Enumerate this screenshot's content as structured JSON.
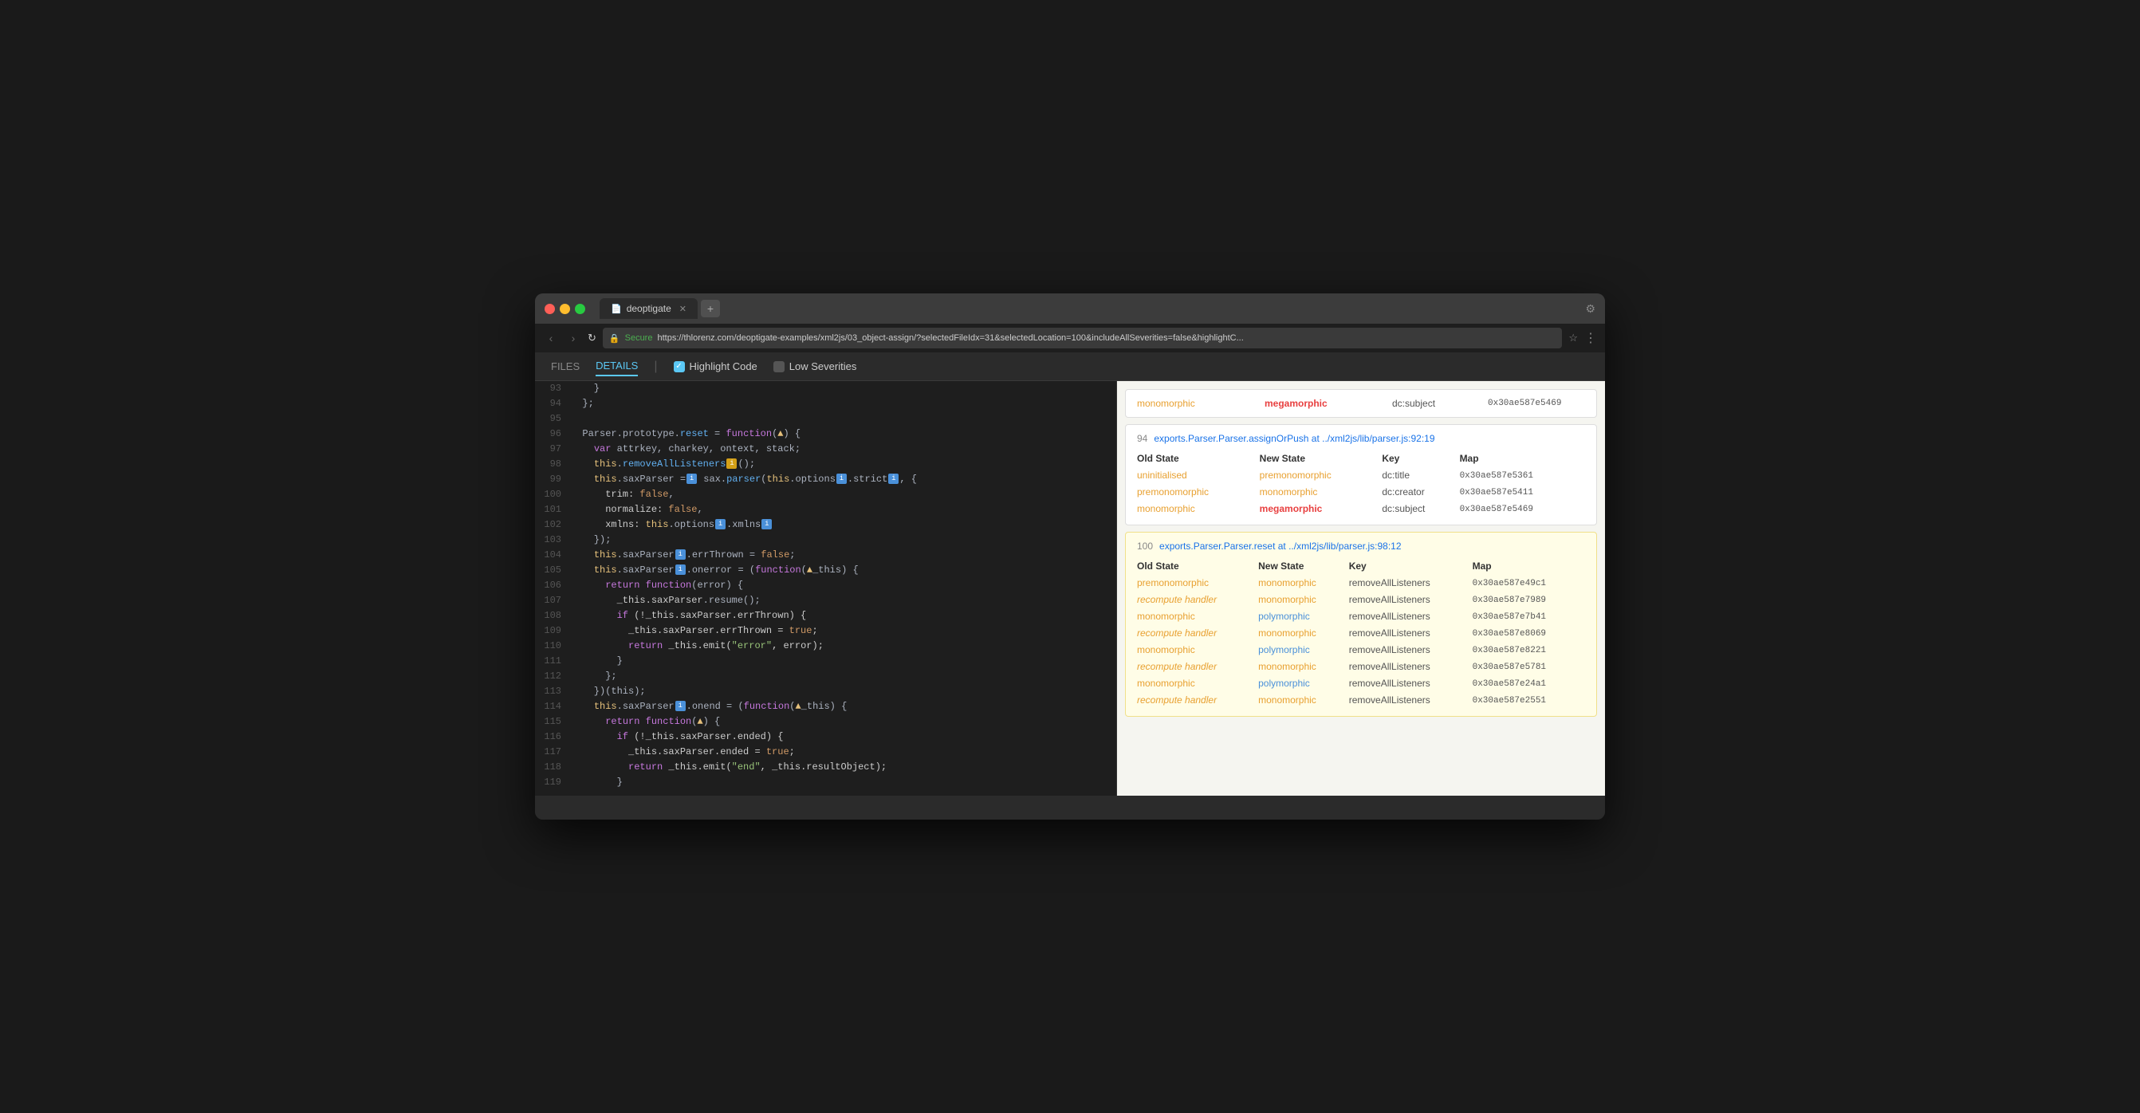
{
  "browser": {
    "title": "deoptigate",
    "url": "https://thlorenz.com/deoptigate-examples/xml2js/03_object-assign/?selectedFileIdx=31&selectedLocation=100&includeAllSeverities=false&highlightC...",
    "secure_label": "Secure"
  },
  "toolbar": {
    "files_label": "FILES",
    "details_label": "DETAILS",
    "highlight_label": "Highlight Code",
    "low_severities_label": "Low Severities"
  },
  "top_ic": {
    "old_state": "monomorphic",
    "new_state": "megamorphic",
    "key": "dc:subject",
    "map": "0x30ae587e5469"
  },
  "ic_cards": [
    {
      "id": "card_94",
      "line_num": "94",
      "location": "exports.Parser.Parser.assignOrPush at ../xml2js/lib/parser.js:92:19",
      "highlighted": false,
      "headers": [
        "Old State",
        "New State",
        "Key",
        "Map"
      ],
      "rows": [
        {
          "old_state": "uninitialised",
          "old_class": "state-uninit",
          "new_state": "premonomorphic",
          "new_class": "state-pre",
          "key": "dc:title",
          "map": "0x30ae587e5361"
        },
        {
          "old_state": "premonomorphic",
          "old_class": "state-pre",
          "new_state": "monomorphic",
          "new_class": "state-mono",
          "key": "dc:creator",
          "map": "0x30ae587e5411"
        },
        {
          "old_state": "monomorphic",
          "old_class": "state-mono",
          "new_state": "megamorphic",
          "new_class": "state-mega",
          "key": "dc:subject",
          "map": "0x30ae587e5469"
        }
      ]
    },
    {
      "id": "card_100",
      "line_num": "100",
      "location": "exports.Parser.Parser.reset at ../xml2js/lib/parser.js:98:12",
      "highlighted": true,
      "headers": [
        "Old State",
        "New State",
        "Key",
        "Map"
      ],
      "rows": [
        {
          "old_state": "premonomorphic",
          "old_class": "state-pre",
          "new_state": "monomorphic",
          "new_class": "state-mono",
          "key": "removeAllListeners",
          "map": "0x30ae587e49c1"
        },
        {
          "old_state": "recompute handler",
          "old_class": "state-recompute",
          "new_state": "monomorphic",
          "new_class": "state-mono",
          "key": "removeAllListeners",
          "map": "0x30ae587e7989"
        },
        {
          "old_state": "monomorphic",
          "old_class": "state-mono",
          "new_state": "polymorphic",
          "new_class": "state-poly",
          "key": "removeAllListeners",
          "map": "0x30ae587e7b41"
        },
        {
          "old_state": "recompute handler",
          "old_class": "state-recompute",
          "new_state": "monomorphic",
          "new_class": "state-mono",
          "key": "removeAllListeners",
          "map": "0x30ae587e8069"
        },
        {
          "old_state": "monomorphic",
          "old_class": "state-mono",
          "new_state": "polymorphic",
          "new_class": "state-poly",
          "key": "removeAllListeners",
          "map": "0x30ae587e8221"
        },
        {
          "old_state": "recompute handler",
          "old_class": "state-recompute",
          "new_state": "monomorphic",
          "new_class": "state-mono",
          "key": "removeAllListeners",
          "map": "0x30ae587e5781"
        },
        {
          "old_state": "monomorphic",
          "old_class": "state-mono",
          "new_state": "polymorphic",
          "new_class": "state-poly",
          "key": "removeAllListeners",
          "map": "0x30ae587e24a1"
        },
        {
          "old_state": "recompute handler",
          "old_class": "state-recompute",
          "new_state": "monomorphic",
          "new_class": "state-mono",
          "key": "removeAllListeners",
          "map": "0x30ae587e2551"
        }
      ]
    }
  ],
  "code_lines": [
    {
      "num": "93",
      "content": "    }"
    },
    {
      "num": "94",
      "content": "  };"
    },
    {
      "num": "95",
      "content": ""
    },
    {
      "num": "96",
      "content": "  Parser.prototype.reset = function(▲) {"
    },
    {
      "num": "97",
      "content": "    var attrkey, charkey, ontext, stack;"
    },
    {
      "num": "98",
      "content": "    this.removeAllListeners□();"
    },
    {
      "num": "99",
      "content": "    this.saxParser =□ sax.parser(this.options□.strict□, {"
    },
    {
      "num": "100",
      "content": "      trim: false,"
    },
    {
      "num": "101",
      "content": "      normalize: false,"
    },
    {
      "num": "102",
      "content": "      xmlns: this.options□.xmlns□"
    },
    {
      "num": "103",
      "content": "    });"
    },
    {
      "num": "104",
      "content": "    this.saxParser□.errThrown = false;"
    },
    {
      "num": "105",
      "content": "    this.saxParser□.onerror = (function(▲_this) {"
    },
    {
      "num": "106",
      "content": "      return function(error) {"
    },
    {
      "num": "107",
      "content": "        _this.saxParser.resume();"
    },
    {
      "num": "108",
      "content": "        if (!_this.saxParser.errThrown) {"
    },
    {
      "num": "109",
      "content": "          _this.saxParser.errThrown = true;"
    },
    {
      "num": "110",
      "content": "          return _this.emit(\"error\", error);"
    },
    {
      "num": "111",
      "content": "        }"
    },
    {
      "num": "112",
      "content": "      };"
    },
    {
      "num": "113",
      "content": "    })(this);"
    },
    {
      "num": "114",
      "content": "    this.saxParser□.onend = (function(▲_this) {"
    },
    {
      "num": "115",
      "content": "      return function(▲) {"
    },
    {
      "num": "116",
      "content": "        if (!_this.saxParser.ended) {"
    },
    {
      "num": "117",
      "content": "          _this.saxParser.ended = true;"
    },
    {
      "num": "118",
      "content": "          return _this.emit(\"end\", _this.resultObject);"
    },
    {
      "num": "119",
      "content": "        }"
    }
  ]
}
